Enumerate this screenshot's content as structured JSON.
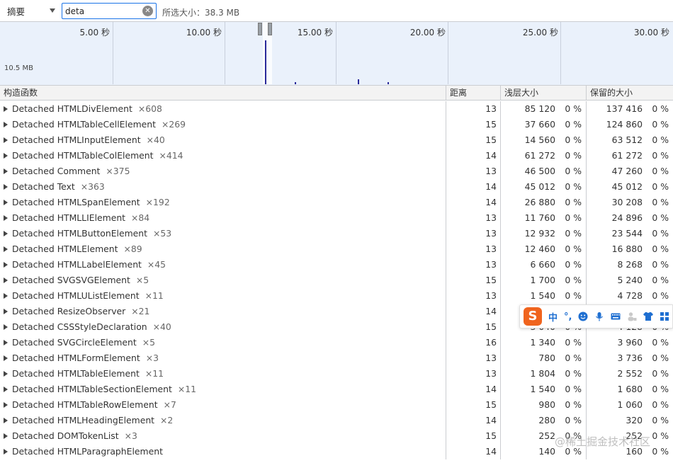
{
  "toolbar": {
    "view_select": "摘要",
    "filter_value": "deta",
    "selected_size": "所选大小：38.3 MB"
  },
  "timeline": {
    "ticks": [
      "5.00 秒",
      "10.00 秒",
      "15.00 秒",
      "20.00 秒",
      "25.00 秒",
      "30.00 秒"
    ],
    "size_label": "10.5 MB"
  },
  "columns": {
    "constructor": "构造函数",
    "distance": "距离",
    "shallow": "浅层大小",
    "retained": "保留的大小"
  },
  "rows": [
    {
      "name": "Detached HTMLDivElement",
      "count": "×608",
      "distance": "13",
      "shallow": "85 120",
      "shallow_pct": "0 %",
      "retained": "137 416",
      "retained_pct": "0 %"
    },
    {
      "name": "Detached HTMLTableCellElement",
      "count": "×269",
      "distance": "15",
      "shallow": "37 660",
      "shallow_pct": "0 %",
      "retained": "124 860",
      "retained_pct": "0 %"
    },
    {
      "name": "Detached HTMLInputElement",
      "count": "×40",
      "distance": "15",
      "shallow": "14 560",
      "shallow_pct": "0 %",
      "retained": "63 512",
      "retained_pct": "0 %"
    },
    {
      "name": "Detached HTMLTableColElement",
      "count": "×414",
      "distance": "14",
      "shallow": "61 272",
      "shallow_pct": "0 %",
      "retained": "61 272",
      "retained_pct": "0 %"
    },
    {
      "name": "Detached Comment",
      "count": "×375",
      "distance": "13",
      "shallow": "46 500",
      "shallow_pct": "0 %",
      "retained": "47 260",
      "retained_pct": "0 %"
    },
    {
      "name": "Detached Text",
      "count": "×363",
      "distance": "14",
      "shallow": "45 012",
      "shallow_pct": "0 %",
      "retained": "45 012",
      "retained_pct": "0 %"
    },
    {
      "name": "Detached HTMLSpanElement",
      "count": "×192",
      "distance": "14",
      "shallow": "26 880",
      "shallow_pct": "0 %",
      "retained": "30 208",
      "retained_pct": "0 %"
    },
    {
      "name": "Detached HTMLLIElement",
      "count": "×84",
      "distance": "13",
      "shallow": "11 760",
      "shallow_pct": "0 %",
      "retained": "24 896",
      "retained_pct": "0 %"
    },
    {
      "name": "Detached HTMLButtonElement",
      "count": "×53",
      "distance": "13",
      "shallow": "12 932",
      "shallow_pct": "0 %",
      "retained": "23 544",
      "retained_pct": "0 %"
    },
    {
      "name": "Detached HTMLElement",
      "count": "×89",
      "distance": "13",
      "shallow": "12 460",
      "shallow_pct": "0 %",
      "retained": "16 880",
      "retained_pct": "0 %"
    },
    {
      "name": "Detached HTMLLabelElement",
      "count": "×45",
      "distance": "13",
      "shallow": "6 660",
      "shallow_pct": "0 %",
      "retained": "8 268",
      "retained_pct": "0 %"
    },
    {
      "name": "Detached SVGSVGElement",
      "count": "×5",
      "distance": "15",
      "shallow": "1 700",
      "shallow_pct": "0 %",
      "retained": "5 240",
      "retained_pct": "0 %"
    },
    {
      "name": "Detached HTMLUListElement",
      "count": "×11",
      "distance": "13",
      "shallow": "1 540",
      "shallow_pct": "0 %",
      "retained": "4 728",
      "retained_pct": "0 %"
    },
    {
      "name": "Detached ResizeObserver",
      "count": "×21",
      "distance": "14",
      "shallow": "",
      "shallow_pct": "",
      "retained": "",
      "retained_pct": ""
    },
    {
      "name": "Detached CSSStyleDeclaration",
      "count": "×40",
      "distance": "15",
      "shallow": "3 040",
      "shallow_pct": "0 %",
      "retained": "4 128",
      "retained_pct": "0 %"
    },
    {
      "name": "Detached SVGCircleElement",
      "count": "×5",
      "distance": "16",
      "shallow": "1 340",
      "shallow_pct": "0 %",
      "retained": "3 960",
      "retained_pct": "0 %"
    },
    {
      "name": "Detached HTMLFormElement",
      "count": "×3",
      "distance": "13",
      "shallow": "780",
      "shallow_pct": "0 %",
      "retained": "3 736",
      "retained_pct": "0 %"
    },
    {
      "name": "Detached HTMLTableElement",
      "count": "×11",
      "distance": "13",
      "shallow": "1 804",
      "shallow_pct": "0 %",
      "retained": "2 552",
      "retained_pct": "0 %"
    },
    {
      "name": "Detached HTMLTableSectionElement",
      "count": "×11",
      "distance": "14",
      "shallow": "1 540",
      "shallow_pct": "0 %",
      "retained": "1 680",
      "retained_pct": "0 %"
    },
    {
      "name": "Detached HTMLTableRowElement",
      "count": "×7",
      "distance": "15",
      "shallow": "980",
      "shallow_pct": "0 %",
      "retained": "1 060",
      "retained_pct": "0 %"
    },
    {
      "name": "Detached HTMLHeadingElement",
      "count": "×2",
      "distance": "14",
      "shallow": "280",
      "shallow_pct": "0 %",
      "retained": "320",
      "retained_pct": "0 %"
    },
    {
      "name": "Detached DOMTokenList",
      "count": "×3",
      "distance": "15",
      "shallow": "252",
      "shallow_pct": "0 %",
      "retained": "252",
      "retained_pct": "0 %"
    },
    {
      "name": "Detached HTMLParagraphElement",
      "count": "",
      "distance": "14",
      "shallow": "140",
      "shallow_pct": "0 %",
      "retained": "160",
      "retained_pct": "0 %"
    }
  ],
  "ime": {
    "logo": "S",
    "mode": "中",
    "punct": "°,"
  },
  "watermark": "@稀土掘金技术社区",
  "colors": {
    "timeline_bg": "#eaf1fb",
    "filter_border": "#1a73e8",
    "ime_orange": "#f0641e",
    "ime_blue": "#1f6fd1",
    "chart_bar": "#2a2a9a"
  }
}
